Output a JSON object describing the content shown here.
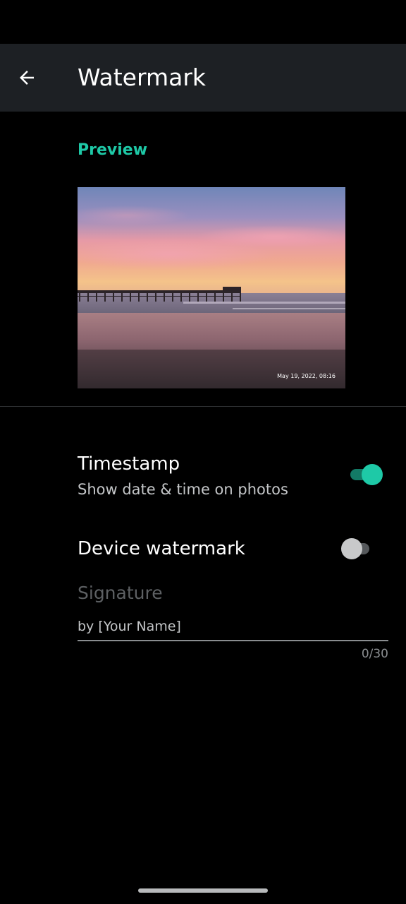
{
  "app_bar": {
    "title": "Watermark",
    "back_icon": "arrow-back-icon"
  },
  "preview": {
    "section_title": "Preview",
    "timestamp_text": "May 19, 2022, 08:16",
    "image_description_icon": "photo"
  },
  "settings": {
    "timestamp": {
      "title": "Timestamp",
      "summary": "Show date & time on photos",
      "enabled": true
    },
    "device_watermark": {
      "title": "Device watermark",
      "enabled": false
    }
  },
  "signature": {
    "label": "Signature",
    "value": "",
    "placeholder": "by [Your Name]",
    "counter": "0/30"
  },
  "colors": {
    "accent": "#1ec9a7",
    "app_bar_bg": "#1d2024",
    "background": "#000000"
  }
}
